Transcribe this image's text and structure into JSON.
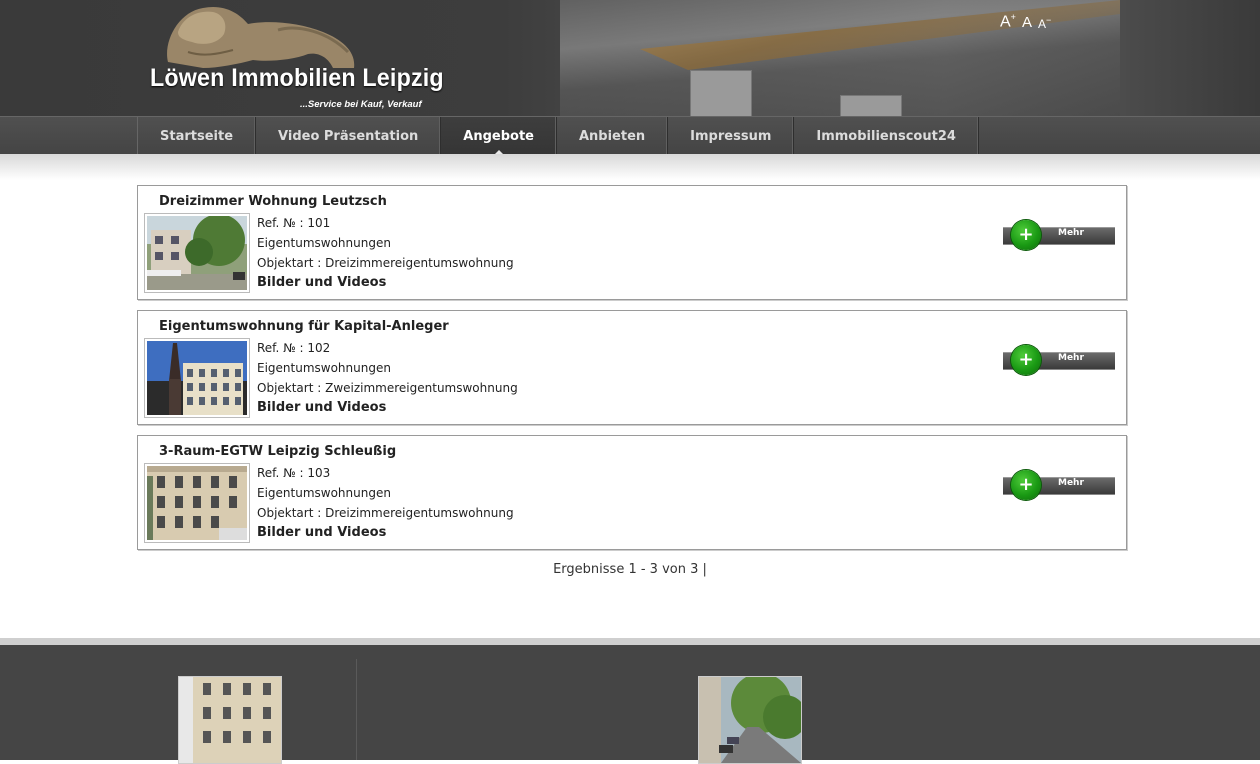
{
  "header": {
    "logo_title": "Löwen Immobilien Leipzig",
    "logo_subtitle": "...Service bei Kauf, Verkauf",
    "font_increase": "A",
    "font_normal": "A",
    "font_decrease": "A"
  },
  "nav": {
    "items": [
      {
        "label": "Startseite"
      },
      {
        "label": "Video Präsentation"
      },
      {
        "label": "Angebote"
      },
      {
        "label": "Anbieten"
      },
      {
        "label": "Impressum"
      },
      {
        "label": "Immobilienscout24"
      }
    ],
    "active": "Angebote"
  },
  "listings": [
    {
      "title": "Dreizimmer Wohnung Leutzsch",
      "ref": "Ref. № : 101",
      "category": "Eigentumswohnungen",
      "objektart": "Objektart : Dreizimmereigentumswohnung",
      "media": "Bilder und Videos",
      "button_label": "Mehr"
    },
    {
      "title": "Eigentumswohnung für Kapital-Anleger",
      "ref": "Ref. № : 102",
      "category": "Eigentumswohnungen",
      "objektart": "Objektart : Zweizimmereigentumswohnung",
      "media": "Bilder und Videos",
      "button_label": "Mehr"
    },
    {
      "title": "3-Raum-EGTW Leipzig Schleußig",
      "ref": "Ref. № : 103",
      "category": "Eigentumswohnungen",
      "objektart": "Objektart : Dreizimmereigentumswohnung",
      "media": "Bilder und Videos",
      "button_label": "Mehr"
    }
  ],
  "results": "Ergebnisse 1 - 3 von 3 |",
  "colors": {
    "header_bg": "#3a3a3a",
    "nav_bg": "#4a4a4a",
    "button_green": "#1a9a14",
    "footer_bg": "#454545"
  }
}
